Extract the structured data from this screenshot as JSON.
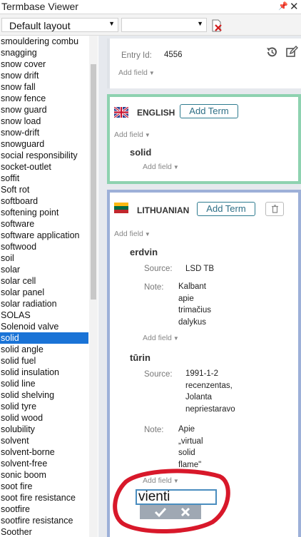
{
  "window": {
    "title": "Termbase Viewer"
  },
  "toolbar": {
    "layout_value": "Default layout"
  },
  "term_list": [
    "smouldering combu",
    "snagging",
    "snow cover",
    "snow drift",
    "snow fall",
    "snow fence",
    "snow guard",
    "snow load",
    "snow-drift",
    "snowguard",
    "social responsibility",
    "socket-outlet",
    "soffit",
    "Soft rot",
    "softboard",
    "softening point",
    "software",
    "software application",
    "softwood",
    "soil",
    "solar",
    "solar cell",
    "solar panel",
    "solar radiation",
    "SOLAS",
    "Solenoid valve",
    "solid",
    "solid angle",
    "solid fuel",
    "solid insulation",
    "solid line",
    "solid shelving",
    "solid tyre",
    "solid wood",
    "solubility",
    "solvent",
    "solvent-borne",
    "solvent-free",
    "sonic boom",
    "soot fire",
    "soot fire resistance",
    "sootfire",
    "sootfire resistance",
    "Soother"
  ],
  "selected_term": "solid",
  "entry": {
    "id_label": "Entry Id:",
    "id_value": "4556",
    "add_field": "Add field"
  },
  "english": {
    "language": "ENGLISH",
    "add_term": "Add Term",
    "add_field": "Add field",
    "term": "solid",
    "term_add_field": "Add field",
    "colors": {
      "border": "#8ed2b0"
    }
  },
  "lithuanian": {
    "language": "LITHUANIAN",
    "add_term": "Add Term",
    "add_field": "Add field",
    "terms": [
      {
        "term": "erdvin",
        "source_label": "Source:",
        "source_value": "LSD TB",
        "note_label": "Note:",
        "note_lines": [
          "Kalbant",
          "apie",
          "trimačius",
          "dalykus"
        ],
        "add_field": "Add field"
      },
      {
        "term": "tūrin",
        "source_label": "Source:",
        "source_lines": [
          "1991-1-2",
          "recenzentas,",
          "Jolanta",
          "nepriestaravo"
        ],
        "note_label": "Note:",
        "note_lines": [
          "Apie",
          "„virtual",
          "solid",
          "flame\""
        ],
        "add_field": "Add field"
      }
    ],
    "new_term_value": "vienti",
    "colors": {
      "border": "#9db0d8"
    }
  },
  "colors": {
    "selection": "#1a73d6",
    "accent": "#2e7b8f",
    "annotation": "#d8182a"
  }
}
